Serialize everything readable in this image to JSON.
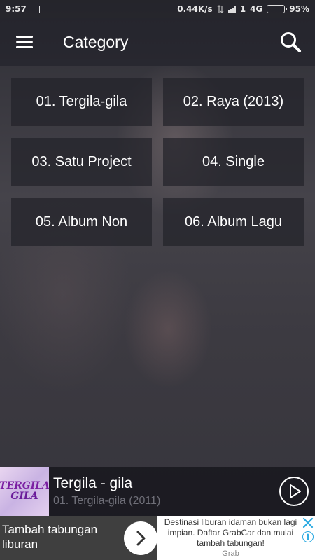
{
  "status_bar": {
    "time": "9:57",
    "speed": "0.44K/s",
    "sim": "1",
    "network": "4G",
    "battery": "95%",
    "battery_level": 0.95
  },
  "app_bar": {
    "title": "Category",
    "menu_icon": "hamburger-menu-icon",
    "search_icon": "search-icon"
  },
  "categories": [
    {
      "label": "01. Tergila-gila"
    },
    {
      "label": "02. Raya (2013)"
    },
    {
      "label": "03. Satu Project"
    },
    {
      "label": "04. Single"
    },
    {
      "label": "05. Album Non"
    },
    {
      "label": "06. Album Lagu"
    }
  ],
  "player": {
    "cover_text_1": "TERGILA",
    "cover_text_2": "GILA",
    "title": "Tergila - gila",
    "subtitle": "01. Tergila-gila (2011)",
    "play_icon": "play-icon"
  },
  "ad": {
    "headline": "Tambah tabungan liburan",
    "description": "Destinasi liburan idaman bukan lagi impian. Daftar GrabCar dan mulai tambah tabungan!",
    "brand": "Grab",
    "next_icon": "chevron-right-icon",
    "close_icon": "close-icon",
    "info_icon": "info-icon",
    "accent": "#29a9e1"
  }
}
